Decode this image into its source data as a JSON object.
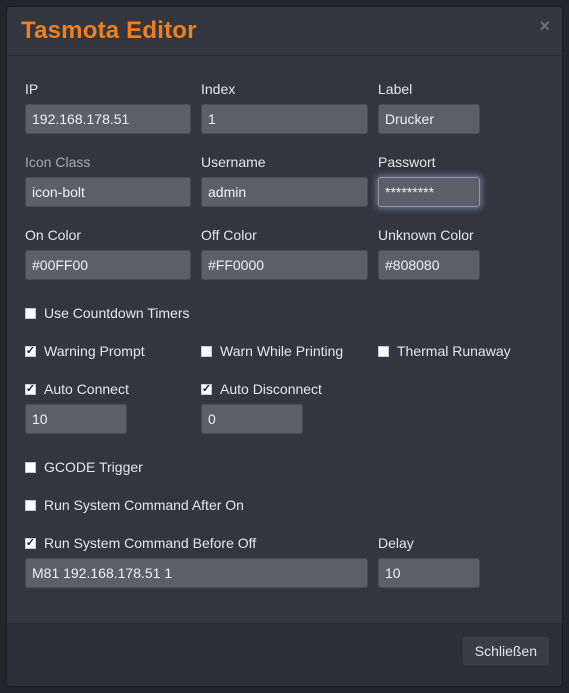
{
  "dialog": {
    "title": "Tasmota Editor",
    "close_glyph": "×",
    "close_button_label": "Schließen"
  },
  "fields": {
    "ip": {
      "label": "IP",
      "value": "192.168.178.51"
    },
    "index": {
      "label": "Index",
      "value": "1"
    },
    "label": {
      "label": "Label",
      "value": "Drucker"
    },
    "icon_class": {
      "label": "Icon Class",
      "value": "icon-bolt"
    },
    "username": {
      "label": "Username",
      "value": "admin"
    },
    "password": {
      "label": "Passwort",
      "value": "*********"
    },
    "on_color": {
      "label": "On Color",
      "value": "#00FF00"
    },
    "off_color": {
      "label": "Off Color",
      "value": "#FF0000"
    },
    "unknown_color": {
      "label": "Unknown Color",
      "value": "#808080"
    },
    "auto_connect_delay": {
      "value": "10"
    },
    "auto_disconnect_delay": {
      "value": "0"
    },
    "command_before_off": {
      "value": "M81 192.168.178.51 1"
    },
    "delay": {
      "label": "Delay",
      "value": "10"
    }
  },
  "checkboxes": {
    "use_countdown_timers": {
      "label": "Use Countdown Timers",
      "checked": false
    },
    "warning_prompt": {
      "label": "Warning Prompt",
      "checked": true
    },
    "warn_while_printing": {
      "label": "Warn While Printing",
      "checked": false
    },
    "thermal_runaway": {
      "label": "Thermal Runaway",
      "checked": false
    },
    "auto_connect": {
      "label": "Auto Connect",
      "checked": true
    },
    "auto_disconnect": {
      "label": "Auto Disconnect",
      "checked": true
    },
    "gcode_trigger": {
      "label": "GCODE Trigger",
      "checked": false
    },
    "run_cmd_after_on": {
      "label": "Run System Command After On",
      "checked": false
    },
    "run_cmd_before_off": {
      "label": "Run System Command Before Off",
      "checked": true
    }
  },
  "colors": {
    "title_accent": "#f07f1e",
    "panel": "#33363f",
    "input_bg": "#5b5f6a"
  }
}
